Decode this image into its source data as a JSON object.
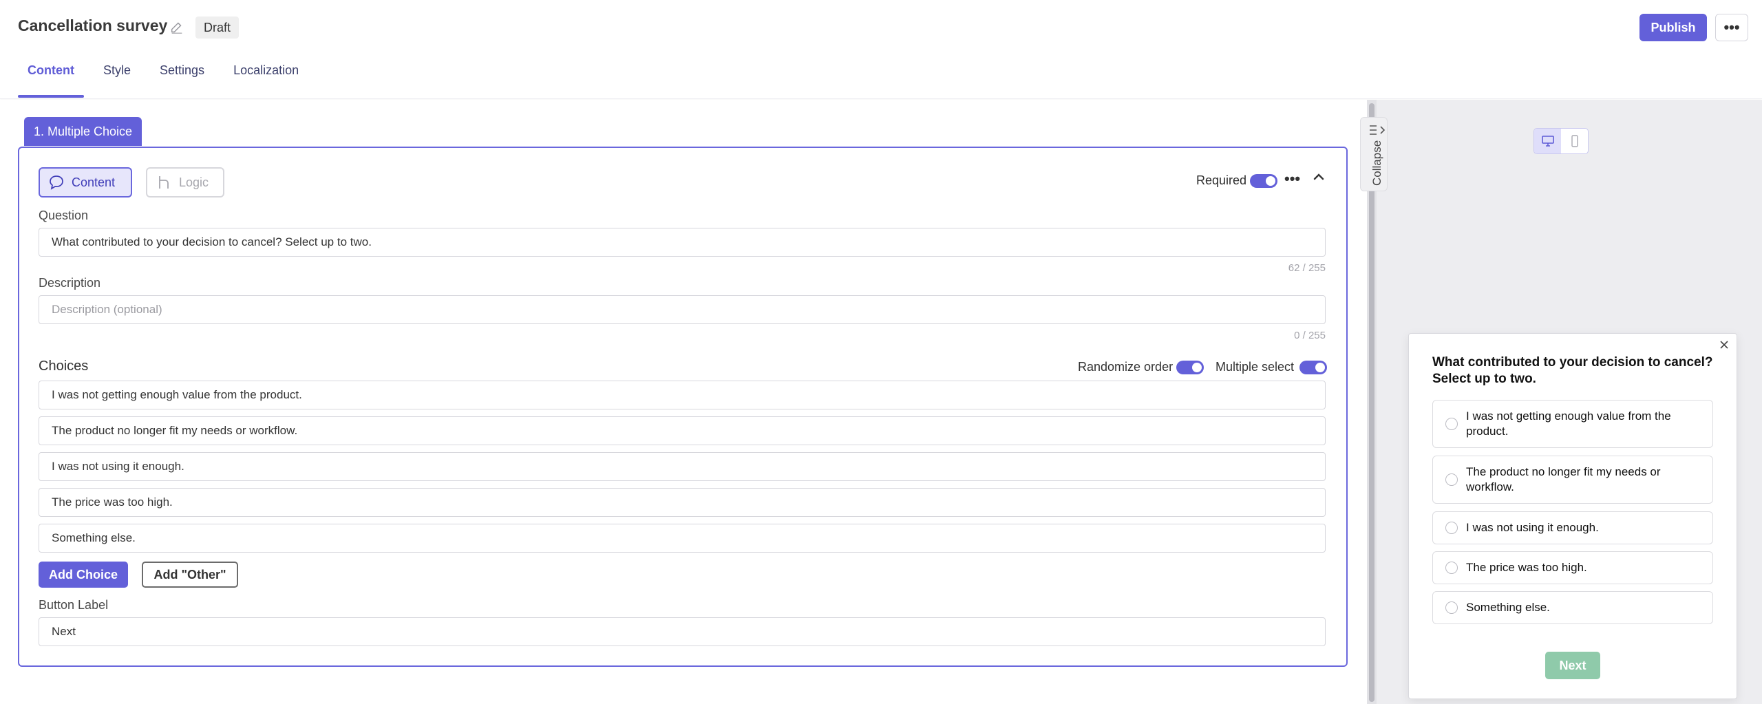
{
  "header": {
    "title": "Cancellation survey",
    "status_badge": "Draft",
    "publish_label": "Publish",
    "more_label": "•••"
  },
  "tabs": [
    {
      "label": "Content",
      "active": true
    },
    {
      "label": "Style",
      "active": false
    },
    {
      "label": "Settings",
      "active": false
    },
    {
      "label": "Localization",
      "active": false
    }
  ],
  "question_card": {
    "tab_label": "1. Multiple Choice",
    "mode_content_label": "Content",
    "mode_logic_label": "Logic",
    "required_label": "Required",
    "required_on": true,
    "more_label": "•••",
    "question_label": "Question",
    "question_value": "What contributed to your decision to cancel? Select up to two.",
    "question_counter": "62 / 255",
    "description_label": "Description",
    "description_placeholder": "Description (optional)",
    "description_counter": "0 / 255",
    "choices_label": "Choices",
    "randomize_label": "Randomize order",
    "randomize_on": true,
    "multiple_select_label": "Multiple select",
    "multiple_select_on": true,
    "choices": [
      "I was not getting enough value from the product.",
      "The product no longer fit my needs or workflow.",
      "I was not using it enough.",
      "The price was too high.",
      "Something else."
    ],
    "add_choice_label": "Add Choice",
    "add_other_label": "Add \"Other\"",
    "button_label_title": "Button Label",
    "button_label_value": "Next"
  },
  "sidebar_handle": {
    "collapse_label": "Collapse"
  },
  "preview": {
    "question": "What contributed to your decision to cancel? Select up to two.",
    "options": [
      "I was not getting enough value from the product.",
      "The product no longer fit my needs or workflow.",
      "I was not using it enough.",
      "The price was too high.",
      "Something else."
    ],
    "next_label": "Next"
  },
  "colors": {
    "accent": "#6360d9",
    "next_button": "#8fcaaa",
    "preview_bg": "#ededf0"
  }
}
